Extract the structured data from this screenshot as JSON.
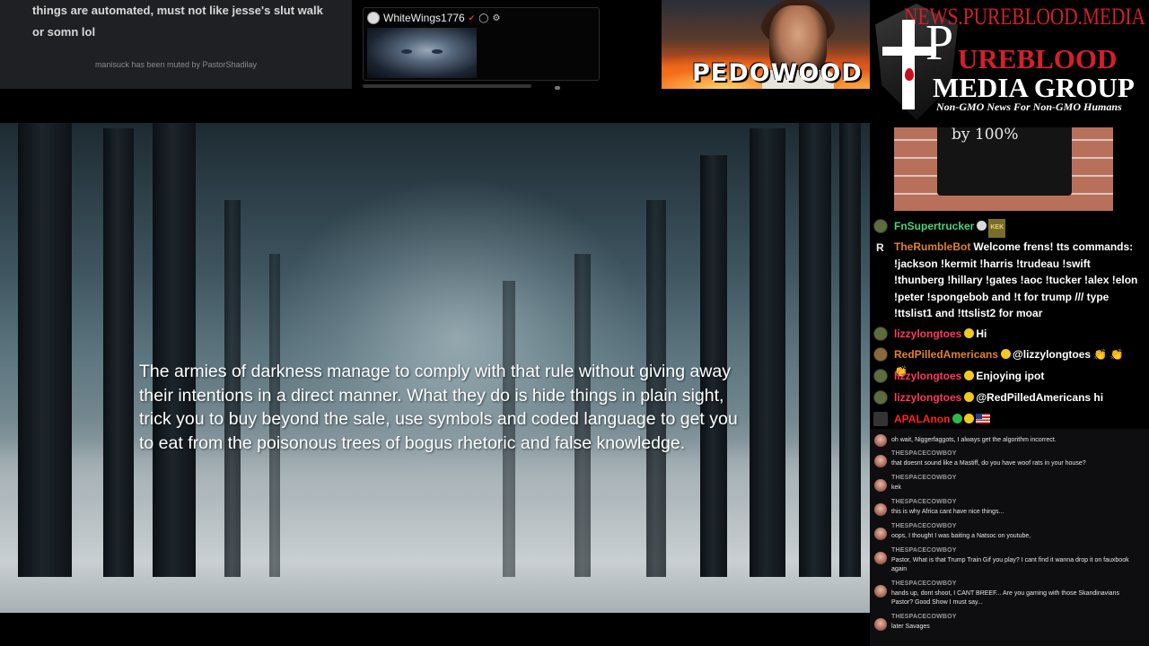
{
  "top_chat": {
    "message": "things are automated, must not like jesse's slut walk or somn lol",
    "notice": "manisuck has been muted by PastorShadilay"
  },
  "cam_card": {
    "username": "WhiteWings1776"
  },
  "pedo_banner": {
    "text": "PEDOWOOD"
  },
  "logo": {
    "url": "NEWS.PUREBLOOD.MEDIA",
    "word_pure": "P",
    "word_ureblood": "UREBLOOD",
    "word_media_group": "MEDIA GROUP",
    "tagline": "Non-GMO News For Non-GMO Humans",
    "accent_color": "#d4202a"
  },
  "video": {
    "subtitle": "The armies of darkness manage to comply with that rule without giving away their intentions in a direct manner. What they do is hide things in plain sight, trick you to buy beyond the sale, use symbols and coded language to get you to eat from the poisonous trees of bogus rhetoric and false knowledge."
  },
  "sign_image": {
    "text": "by 100%"
  },
  "rumble_chat": {
    "messages": [
      {
        "user": "FnSupertrucker",
        "color": "#4fd07a",
        "text": "",
        "badge": "KEK"
      },
      {
        "user": "TheRumbleBot",
        "color": "#e0832a",
        "text": "Welcome frens! tts commands: !jackson !kermit !harris !trudeau !swift !thunberg !hillary !gates !aoc !tucker !alex !elon !peter !spongebob and !t for trump /// type !ttslist1 and !ttslist2 for moar"
      },
      {
        "user": "lizzylongtoes",
        "color": "#ff3a5a",
        "text": "Hi"
      },
      {
        "user": "RedPilledAmericans",
        "color": "#e0832a",
        "text": "@lizzylongtoes 👏 👏 👏"
      },
      {
        "user": "lizzylongtoes",
        "color": "#ff3a5a",
        "text": "Enjoying ipot"
      },
      {
        "user": "lizzylongtoes",
        "color": "#ff3a5a",
        "text": "@RedPilledAmericans hi"
      },
      {
        "user": "APALAnon",
        "color": "#ff2222",
        "text": ""
      }
    ]
  },
  "small_chat": {
    "messages": [
      {
        "user": "",
        "text": "oh wait, Niggerfaggots, I always get the algorithm incorrect."
      },
      {
        "user": "THESPACECOWBOY",
        "text": "that doesnt sound like a Mastiff, do you have woof rats in your house?"
      },
      {
        "user": "THESPACECOWBOY",
        "text": "kek"
      },
      {
        "user": "THESPACECOWBOY",
        "text": "this is why Africa cant have nice things..."
      },
      {
        "user": "THESPACECOWBOY",
        "text": "oops, I thought I was baiting a Natsoc on youtube,"
      },
      {
        "user": "THESPACECOWBOY",
        "text": "Pastor, What is that Trump Train Gif you play? I cant find it wanna drop it on fauxbook again"
      },
      {
        "user": "THESPACECOWBOY",
        "text": "hands up, dont shoot, I CANT BREEF... Are you gaming with those Skandinavians Pastor? Good Show I must say..."
      },
      {
        "user": "THESPACECOWBOY",
        "text": "later Savages"
      }
    ]
  }
}
